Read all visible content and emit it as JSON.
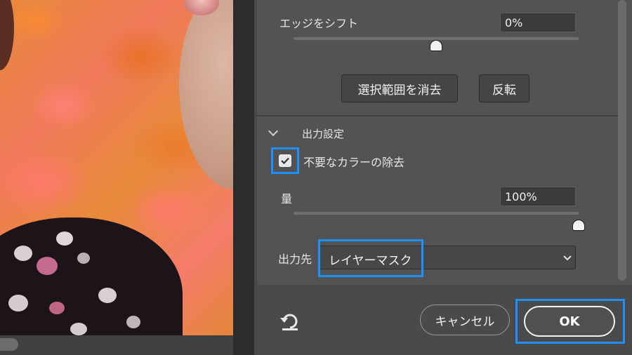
{
  "edge_shift": {
    "label": "エッジをシフト",
    "value": "0%",
    "slider_fraction": 0.5
  },
  "buttons": {
    "clear_selection": "選択範囲を消去",
    "invert": "反転"
  },
  "output_settings": {
    "section_title": "出力設定",
    "decontaminate_checkbox": {
      "label": "不要なカラーの除去",
      "checked": true
    },
    "amount": {
      "label": "量",
      "value": "100%",
      "slider_fraction": 1.0
    },
    "output_to": {
      "label": "出力先",
      "selected": "レイヤーマスク"
    }
  },
  "footer": {
    "cancel_label": "キャンセル",
    "ok_label": "OK",
    "reset_icon": "reset-icon"
  },
  "colors": {
    "highlight": "#1e90ff",
    "panel": "#535353"
  }
}
